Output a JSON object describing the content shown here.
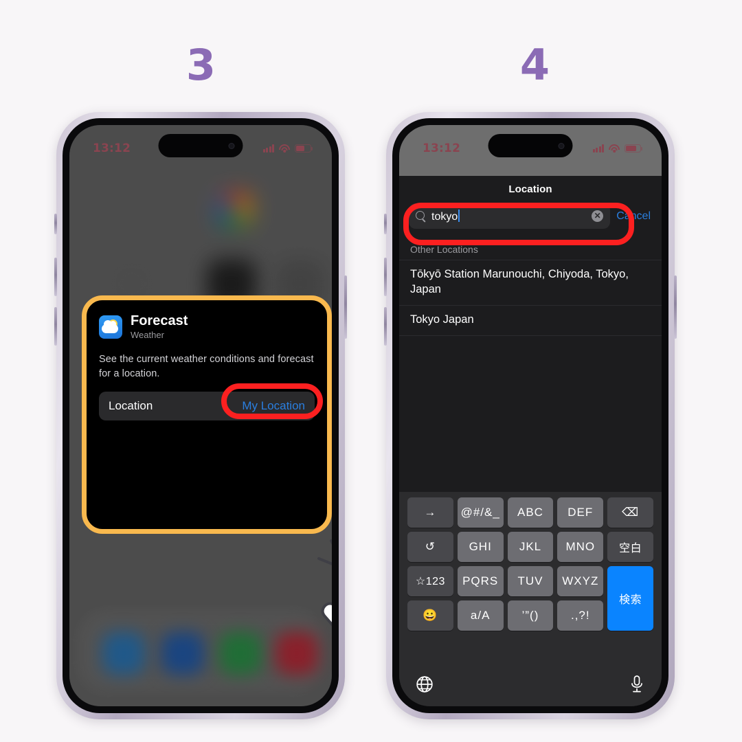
{
  "steps": [
    {
      "number": "3"
    },
    {
      "number": "4"
    }
  ],
  "phone_left": {
    "status_bar": {
      "time": "13:12",
      "signal_icon": "cellular-signal-icon",
      "wifi_icon": "wifi-icon",
      "battery_icon": "battery-icon"
    },
    "widget_card": {
      "app_icon": "weather-app-icon",
      "title": "Forecast",
      "subtitle": "Weather",
      "description": "See the current weather conditions and forecast for a location.",
      "parameter_label": "Location",
      "parameter_value": "My Location",
      "highlight_color": "#f9b94e",
      "focus_color": "#fc2020"
    },
    "cursor": "pointing-hand-cursor"
  },
  "phone_right": {
    "status_bar": {
      "time": "13:12",
      "signal_icon": "cellular-signal-icon",
      "wifi_icon": "wifi-icon",
      "battery_icon": "battery-icon"
    },
    "sheet": {
      "title": "Location",
      "search": {
        "icon": "search-icon",
        "value": "tokyo",
        "clear_icon": "clear-circle-icon"
      },
      "cancel_label": "Cancel",
      "section_header": "Other Locations",
      "results": [
        "Tōkyō Station Marunouchi, Chiyoda, Tokyo, Japan",
        "Tokyo Japan"
      ],
      "focus_color": "#fc2020"
    },
    "keyboard": {
      "keys": [
        {
          "label": "→",
          "style": "dark",
          "name": "key-next"
        },
        {
          "label": "@#/&_",
          "style": "light",
          "name": "key-symbols"
        },
        {
          "label": "ABC",
          "style": "light",
          "name": "key-abc"
        },
        {
          "label": "DEF",
          "style": "light",
          "name": "key-def"
        },
        {
          "label": "⌫",
          "style": "dark",
          "name": "key-backspace"
        },
        {
          "label": "↺",
          "style": "dark",
          "name": "key-undo"
        },
        {
          "label": "GHI",
          "style": "light",
          "name": "key-ghi"
        },
        {
          "label": "JKL",
          "style": "light",
          "name": "key-jkl"
        },
        {
          "label": "MNO",
          "style": "light",
          "name": "key-mno"
        },
        {
          "label": "空白",
          "style": "dark",
          "name": "key-space"
        },
        {
          "label": "☆123",
          "style": "dark",
          "name": "key-numbers"
        },
        {
          "label": "PQRS",
          "style": "light",
          "name": "key-pqrs"
        },
        {
          "label": "TUV",
          "style": "light",
          "name": "key-tuv"
        },
        {
          "label": "WXYZ",
          "style": "light",
          "name": "key-wxyz"
        },
        {
          "label": "😀",
          "style": "dark",
          "name": "key-emoji"
        },
        {
          "label": "a/A",
          "style": "light",
          "name": "key-case"
        },
        {
          "label": "’”()",
          "style": "light",
          "name": "key-quotes"
        },
        {
          "label": ".,?!",
          "style": "light",
          "name": "key-punctuation"
        }
      ],
      "search_key_label": "検索",
      "globe_icon": "globe-icon",
      "mic_icon": "microphone-icon"
    }
  }
}
